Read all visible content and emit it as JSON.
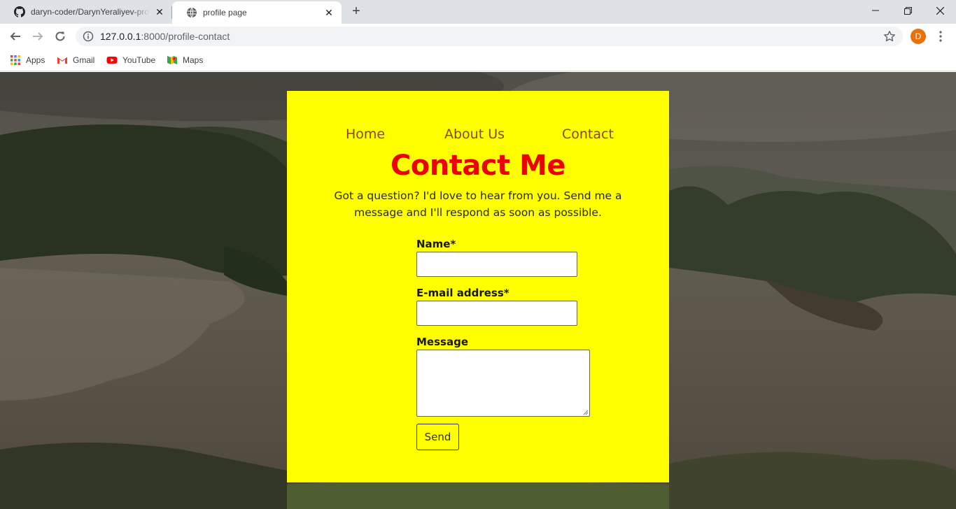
{
  "browser": {
    "tabs": [
      {
        "title": "daryn-coder/DarynYeraliyev-profile",
        "icon": "github-icon",
        "active": false
      },
      {
        "title": "profile page",
        "icon": "globe-icon",
        "active": true
      }
    ],
    "address_bar": {
      "host": "127.0.0.1",
      "path": ":8000/profile-contact"
    },
    "profile_initial": "D",
    "bookmarks": [
      {
        "label": "Apps",
        "icon": "apps-grid-icon"
      },
      {
        "label": "Gmail",
        "icon": "gmail-icon"
      },
      {
        "label": "YouTube",
        "icon": "youtube-icon"
      },
      {
        "label": "Maps",
        "icon": "maps-icon"
      }
    ]
  },
  "page": {
    "nav": [
      "Home",
      "About Us",
      "Contact"
    ],
    "heading": "Contact Me",
    "intro": "Got a question? I'd love to hear from you. Send me a message and I'll respond as soon as possible.",
    "form": {
      "name_label": "Name*",
      "name_value": "",
      "email_label": "E-mail address*",
      "email_value": "",
      "message_label": "Message",
      "message_value": "",
      "send_label": "Send"
    }
  },
  "colors": {
    "card_bg": "#ffff00",
    "heading": "#ee0000",
    "nav_link": "#8a4a00",
    "tabstrip": "#dee1e6",
    "profile_avatar": "#e8710a"
  }
}
